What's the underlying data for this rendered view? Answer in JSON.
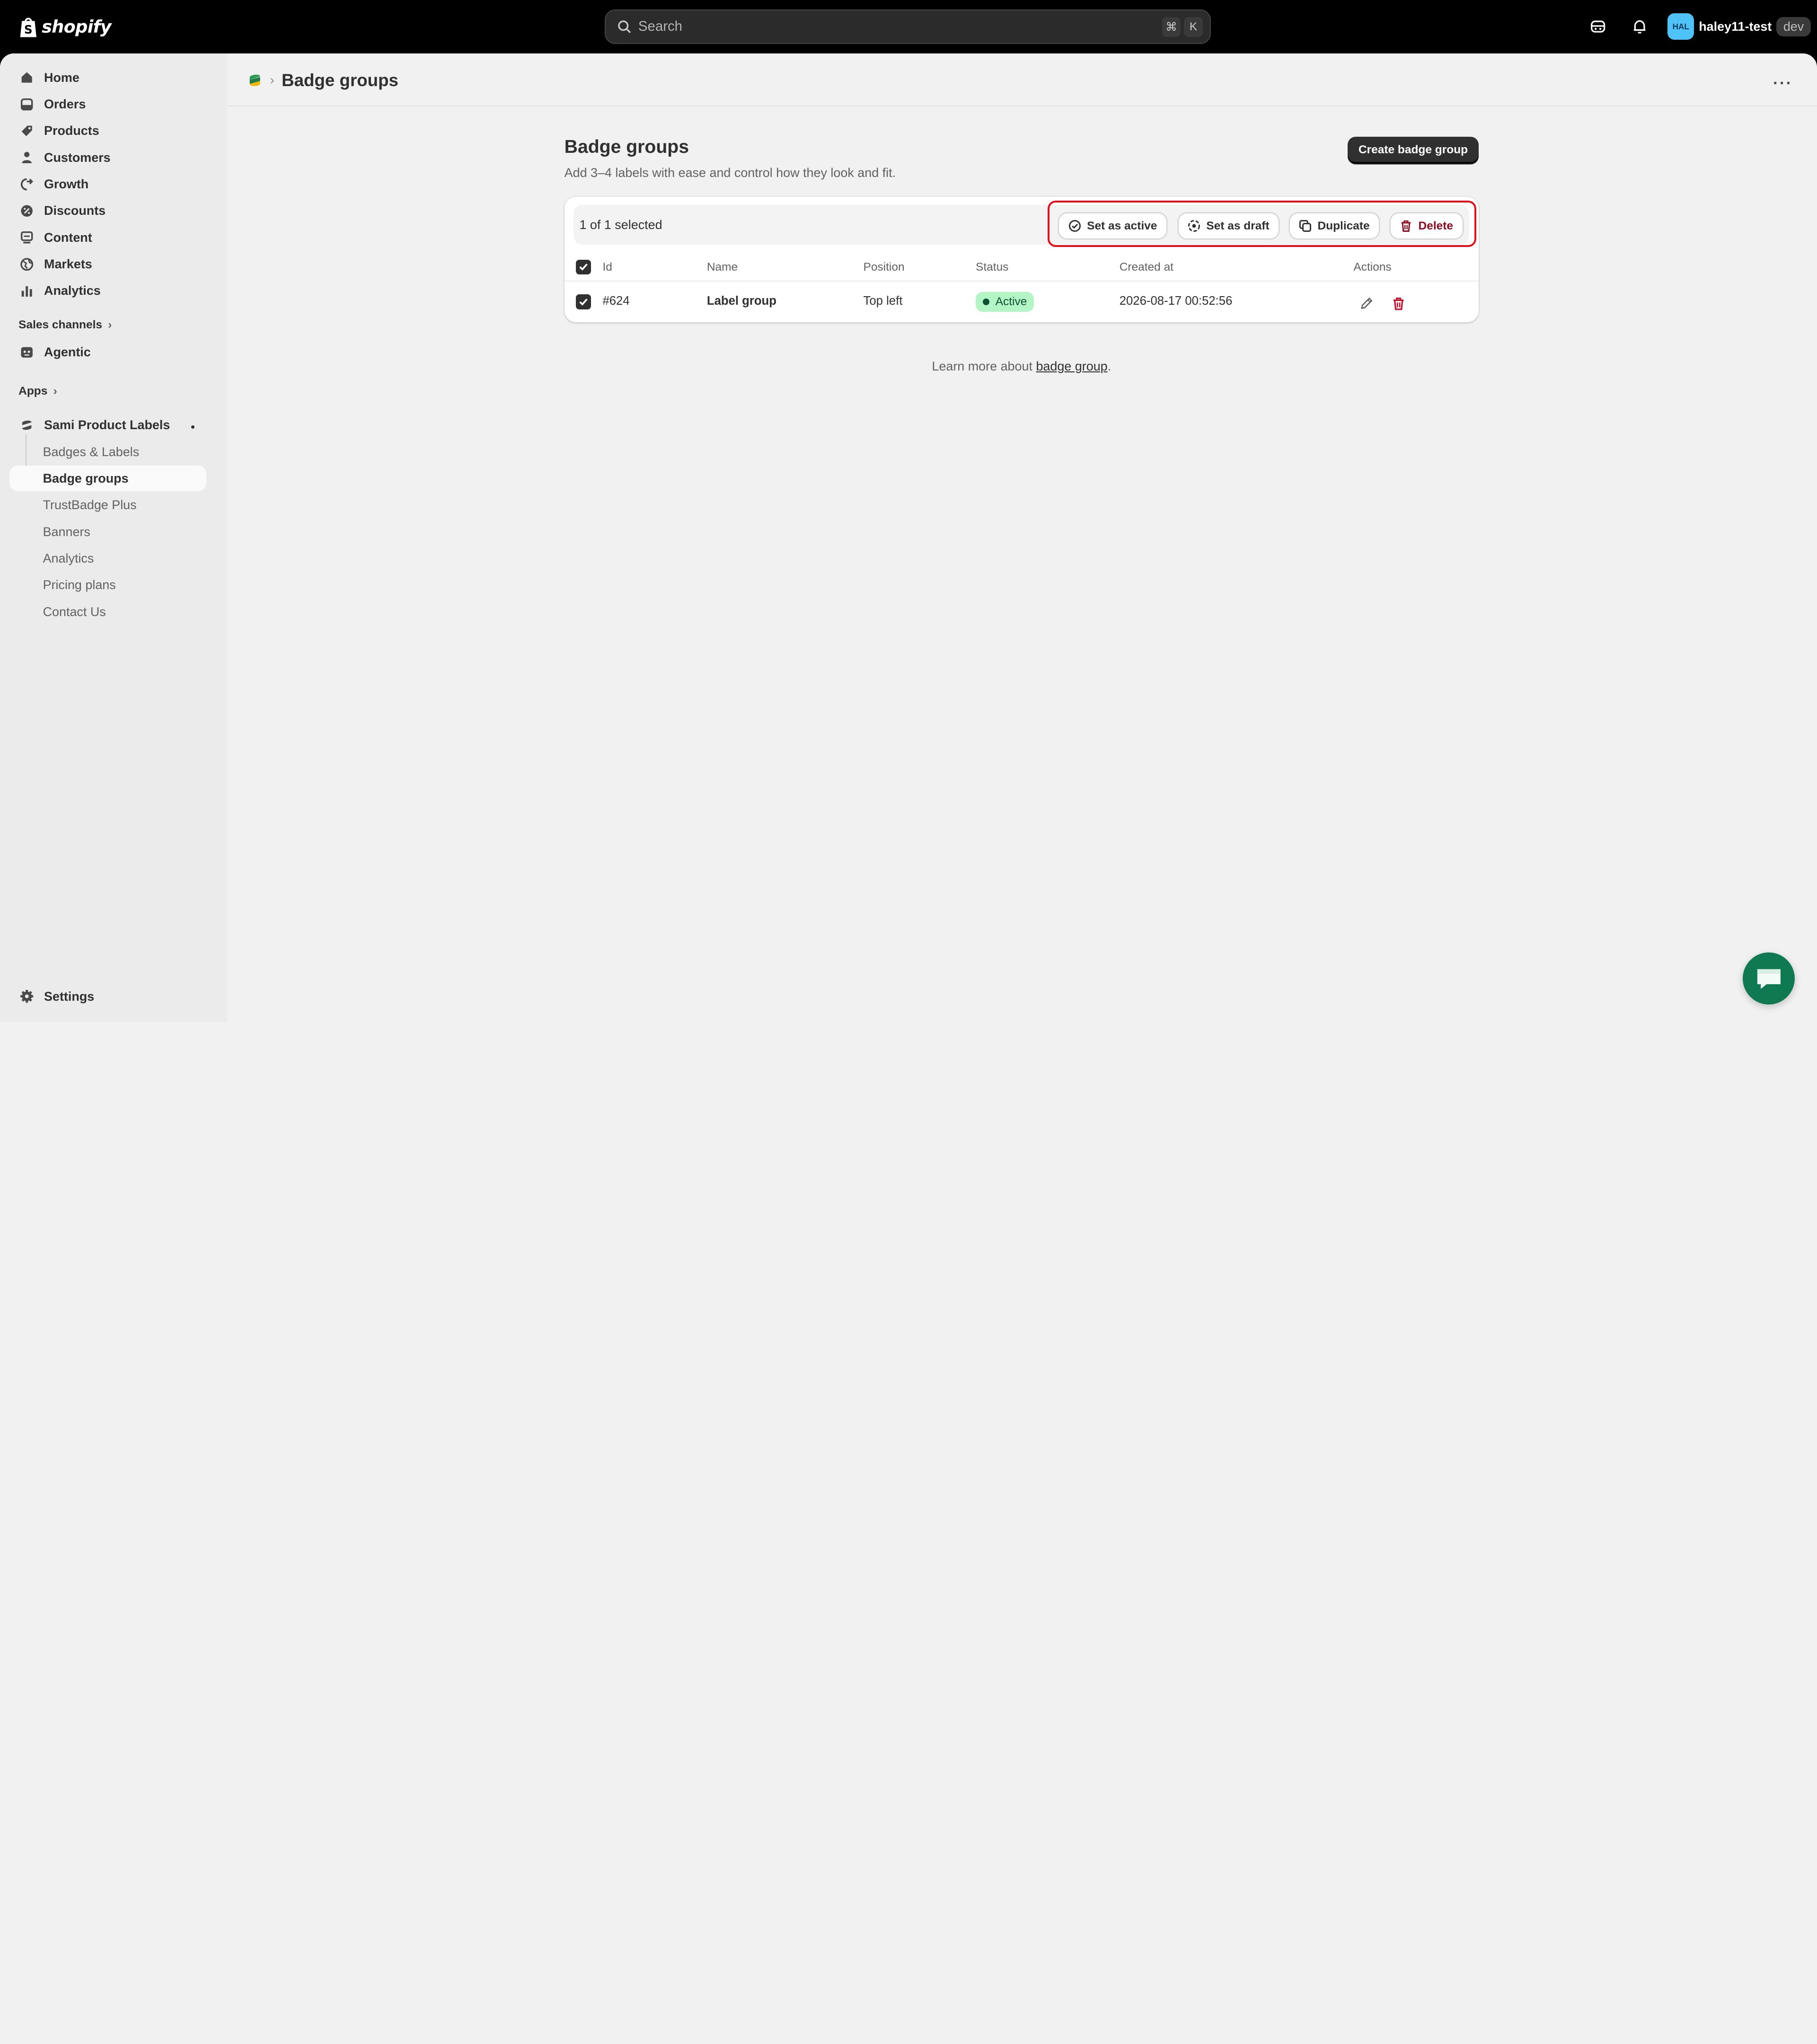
{
  "topbar": {
    "logo_text": "shopify",
    "search_placeholder": "Search",
    "shortcut_key1": "⌘",
    "shortcut_key2": "K",
    "avatar_initials": "HAL",
    "store_name": "haley11-test",
    "env_badge": "dev"
  },
  "sidebar": {
    "main_items": [
      {
        "label": "Home",
        "icon": "home-icon"
      },
      {
        "label": "Orders",
        "icon": "orders-icon"
      },
      {
        "label": "Products",
        "icon": "tag-icon"
      },
      {
        "label": "Customers",
        "icon": "person-icon"
      },
      {
        "label": "Growth",
        "icon": "growth-icon"
      },
      {
        "label": "Discounts",
        "icon": "discount-icon"
      },
      {
        "label": "Content",
        "icon": "content-icon"
      },
      {
        "label": "Markets",
        "icon": "globe-icon"
      },
      {
        "label": "Analytics",
        "icon": "bar-chart-icon"
      }
    ],
    "sales_channels_label": "Sales channels",
    "agentic_label": "Agentic",
    "apps_label": "Apps",
    "app_name": "Sami Product Labels",
    "app_sub_items": [
      {
        "label": "Badges & Labels"
      },
      {
        "label": "Badge groups"
      },
      {
        "label": "TrustBadge Plus"
      },
      {
        "label": "Banners"
      },
      {
        "label": "Analytics"
      },
      {
        "label": "Pricing plans"
      },
      {
        "label": "Contact Us"
      }
    ],
    "settings_label": "Settings"
  },
  "header": {
    "breadcrumb_title": "Badge groups"
  },
  "main": {
    "title": "Badge groups",
    "subtitle": "Add 3–4 labels with ease and control how they look and fit.",
    "create_button": "Create badge group",
    "selection_text": "1 of 1 selected",
    "bulk_actions": {
      "set_active": "Set as active",
      "set_draft": "Set as draft",
      "duplicate": "Duplicate",
      "delete": "Delete"
    },
    "columns": {
      "id": "Id",
      "name": "Name",
      "position": "Position",
      "status": "Status",
      "created_at": "Created at",
      "actions": "Actions"
    },
    "rows": [
      {
        "id": "#624",
        "name": "Label group",
        "position": "Top left",
        "status": "Active",
        "created_at": "2026-08-17 00:52:56"
      }
    ],
    "learn_prefix": "Learn more about ",
    "learn_link": "badge group",
    "learn_suffix": "."
  },
  "colors": {
    "highlight": "#e0111b",
    "status_active_bg": "#b4f5c6",
    "danger": "#8e0b21",
    "chat_button": "#0f7a52"
  }
}
